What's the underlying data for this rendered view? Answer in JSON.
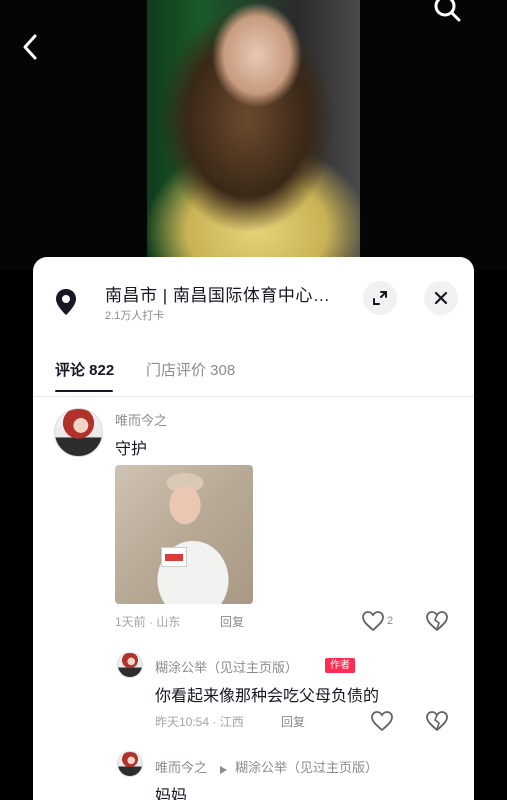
{
  "topbar": {
    "back_icon": "chevron-left-icon",
    "search_icon": "search-icon"
  },
  "location": {
    "title": "南昌市 | 南昌国际体育中心…",
    "subtitle": "2.1万人打卡",
    "pin_icon": "location-pin-icon",
    "expand_icon": "expand-icon",
    "close_icon": "close-icon"
  },
  "tabs": [
    {
      "label": "评论 822",
      "active": true
    },
    {
      "label": "门店评价 308",
      "active": false
    }
  ],
  "comments": [
    {
      "author": "唯而今之",
      "text": "守护",
      "meta": "1天前 · 山东",
      "reply_label": "回复",
      "likes": "2",
      "replies": [
        {
          "author": "糊涂公举（见过主页版）",
          "badge": "作者",
          "text": "你看起来像那种会吃父母负债的",
          "meta": "昨天10:54 · 江西",
          "reply_label": "回复"
        },
        {
          "author": "唯而今之",
          "reply_to": "糊涂公举（见过主页版）",
          "text": "妈妈"
        }
      ]
    }
  ],
  "colors": {
    "accent": "#fe2c55",
    "text_primary": "#161823",
    "text_secondary": "#8a8b91"
  }
}
